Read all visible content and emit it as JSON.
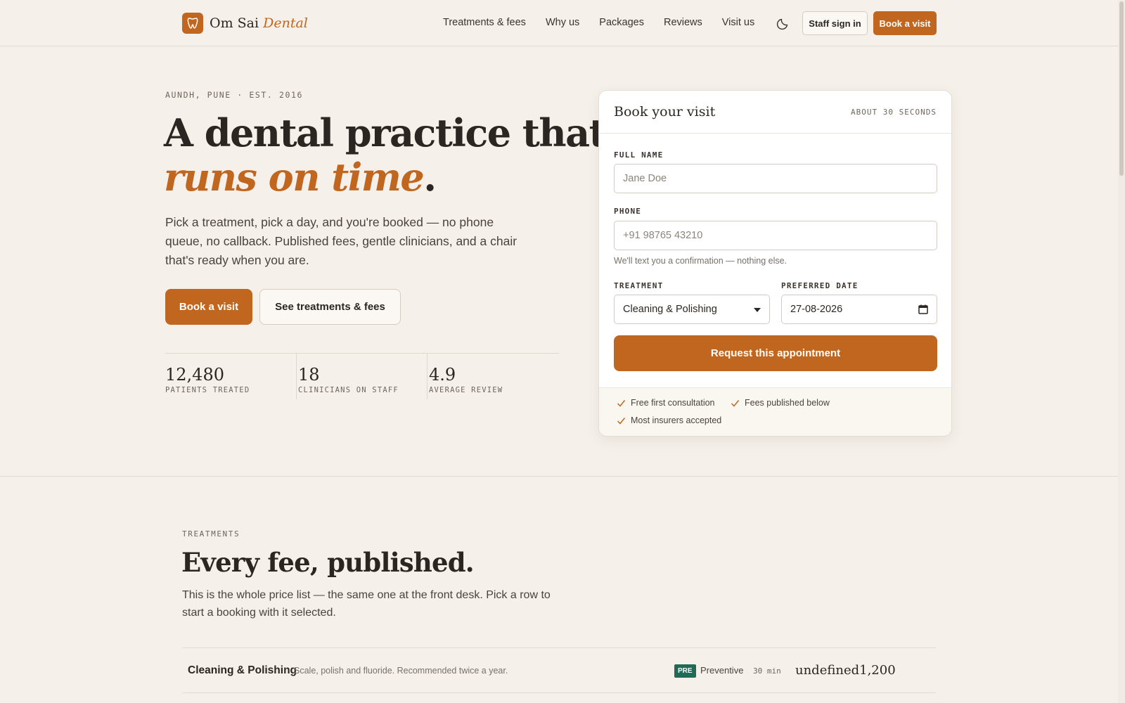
{
  "header": {
    "brand_main": "Om Sai",
    "brand_accent": "Dental",
    "nav": [
      "Treatments & fees",
      "Why us",
      "Packages",
      "Reviews",
      "Visit us"
    ],
    "staff_sign_in": "Staff sign in",
    "book_visit": "Book a visit"
  },
  "hero": {
    "eyebrow": "AUNDH, PUNE · EST. 2016",
    "title_line1": "A dental practice that",
    "title_accent": "runs on time",
    "title_period": ".",
    "paragraph": "Pick a treatment, pick a day, and you're booked — no phone queue, no callback. Published fees, gentle clinicians, and a chair that's ready when you are.",
    "cta_primary": "Book a visit",
    "cta_secondary": "See treatments & fees",
    "stats": [
      {
        "value": "12,480",
        "label": "PATIENTS TREATED"
      },
      {
        "value": "18",
        "label": "CLINICIANS ON STAFF"
      },
      {
        "value": "4.9",
        "label": "AVERAGE REVIEW"
      }
    ]
  },
  "booking": {
    "title": "Book your visit",
    "meta": "ABOUT 30 SECONDS",
    "name_label": "FULL NAME",
    "name_placeholder": "Jane Doe",
    "phone_label": "PHONE",
    "phone_placeholder": "+91 98765 43210",
    "phone_hint": "We'll text you a confirmation — nothing else.",
    "treatment_label": "TREATMENT",
    "treatment_value": "Cleaning & Polishing",
    "date_label": "PREFERRED DATE",
    "date_value": "27-08-2026",
    "submit": "Request this appointment",
    "perks": [
      "Free first consultation",
      "Fees published below",
      "Most insurers accepted"
    ]
  },
  "treatments": {
    "eyebrow": "TREATMENTS",
    "title": "Every fee, published.",
    "paragraph": "This is the whole price list — the same one at the front desk. Pick a row to start a booking with it selected.",
    "rows": [
      {
        "name": "Cleaning & Polishing",
        "desc": "Scale, polish and fluoride. Recommended twice a year.",
        "badge": "PRE",
        "category": "Preventive",
        "duration": "30 min",
        "price": "undefined1,200"
      }
    ]
  },
  "colors": {
    "accent": "#c0661f",
    "background": "#f5f0e9",
    "badge": "#1f6b55"
  }
}
